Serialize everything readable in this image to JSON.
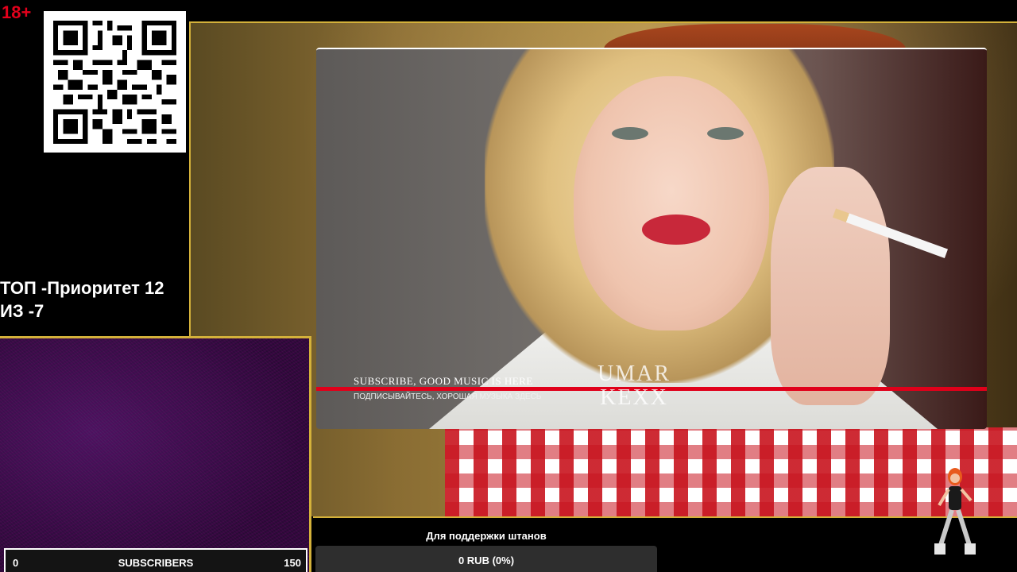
{
  "overlay": {
    "age_badge": "18+",
    "priority_line1": "ТОП -Приоритет 12",
    "priority_line2": "ИЗ -7"
  },
  "video": {
    "caption_en": "SUBSCRIBE, GOOD MUSIC IS HERE",
    "caption_ru": "ПОДПИСЫВАЙТЕСЬ, ХОРОШАЯ МУЗЫКА ЗДЕСЬ",
    "watermark": "UMAR\nKEXX"
  },
  "subscribers": {
    "min": "0",
    "label": "SUBSCRIBERS",
    "max": "150"
  },
  "donation": {
    "title": "Для поддержки штанов",
    "value": "0 RUB (0%)"
  },
  "colors": {
    "gold_border": "#d4b13a",
    "red_badge": "#e3001b",
    "progress_red": "#e0001a"
  },
  "icons": {
    "qr": "qr-code-icon",
    "dancer": "dancing-figure-icon"
  }
}
